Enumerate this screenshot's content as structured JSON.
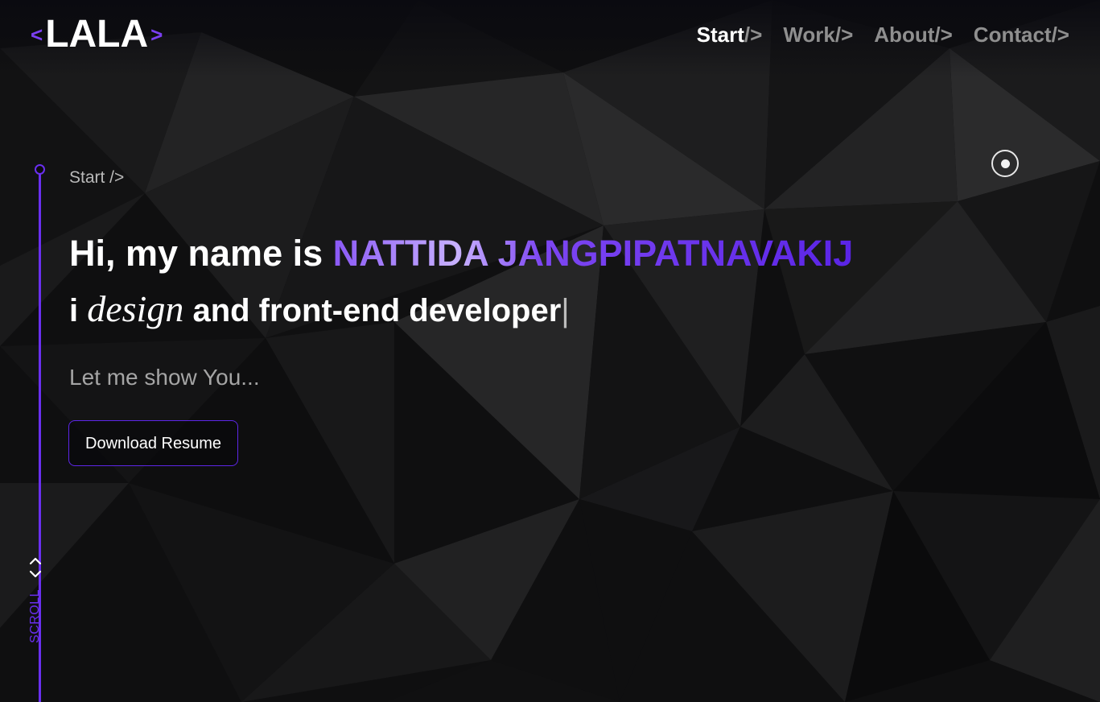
{
  "logo": {
    "left_bracket": "<",
    "text": "LALA",
    "right_bracket": ">"
  },
  "nav": {
    "items": [
      {
        "label": "Start",
        "suffix": "/>",
        "active": true
      },
      {
        "label": "Work",
        "suffix": "/>",
        "active": false
      },
      {
        "label": "About",
        "suffix": "/>",
        "active": false
      },
      {
        "label": "Contact",
        "suffix": "/>",
        "active": false
      }
    ]
  },
  "hero": {
    "breadcrumb": "Start />",
    "greeting": "Hi, my name is ",
    "name": "NATTIDA JANGPIPATNAVAKIJ",
    "role_prefix": "i ",
    "role_italic": "design",
    "role_rest": " and front-end developer",
    "caret": "|",
    "lead": "Let me show You...",
    "button_label": "Download Resume"
  },
  "sidebar": {
    "scroll_label": "SCROLL"
  },
  "colors": {
    "accent": "#6a2ff0",
    "accent_light": "#c8b2ff",
    "background": "#0d0d0e",
    "text_primary": "#ffffff",
    "text_muted": "#8f8f8f"
  },
  "icons": {
    "toggle": "circle-dot-icon",
    "scroll": "chevron-up-down-icon"
  }
}
